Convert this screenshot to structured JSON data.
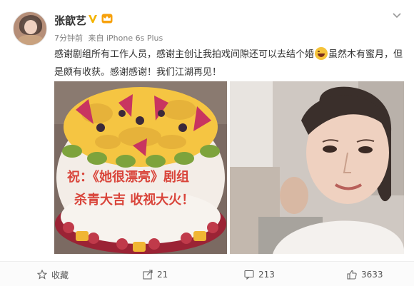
{
  "post": {
    "username": "张歆艺",
    "time": "7分钟前",
    "source": "来自 iPhone 6s Plus",
    "text_part1": "感谢剧组所有工作人员，感谢主创让我拍戏间隙还可以去结个婚",
    "text_part2": "虽然木有蜜月，但是颇有收获。感谢感谢！我们江湖再见！",
    "emoji": "laugh-emoji",
    "cake_text_line1": "祝：《她很漂亮》剧组",
    "cake_text_line2": "杀青大吉 收视大火！"
  },
  "actions": {
    "favorite_label": "收藏",
    "share_count": "21",
    "comment_count": "213",
    "like_count": "3633"
  },
  "colors": {
    "accent_orange": "#f7a10c",
    "vip_gold": "#f4b400",
    "text_dark": "#333333",
    "text_meta": "#808080"
  }
}
